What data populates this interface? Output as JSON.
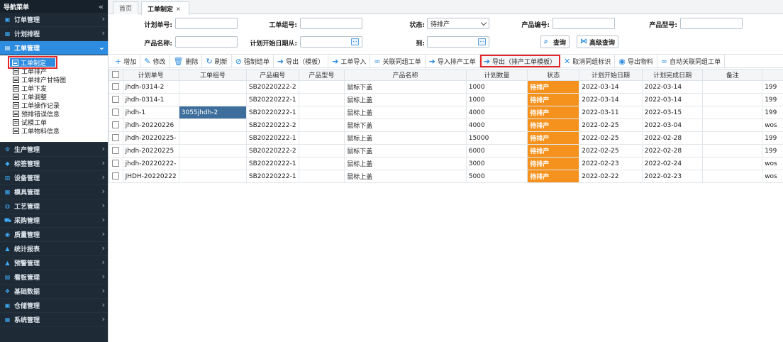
{
  "sidebar": {
    "title": "导航菜单",
    "collapse_icon": "«",
    "top_items": [
      {
        "label": "订单管理",
        "icon": "order-icon"
      },
      {
        "label": "计划排程",
        "icon": "schedule-icon"
      },
      {
        "label": "工单管理",
        "icon": "workorder-icon"
      }
    ],
    "sub_items": [
      {
        "label": "工单制定"
      },
      {
        "label": "工单排产"
      },
      {
        "label": "工单排产甘特图"
      },
      {
        "label": "工单下发"
      },
      {
        "label": "工单调整"
      },
      {
        "label": "工单操作记录"
      },
      {
        "label": "预排错误信息"
      },
      {
        "label": "试模工单"
      },
      {
        "label": "工单物料信息"
      }
    ],
    "bottom_items": [
      {
        "label": "生产管理"
      },
      {
        "label": "标签管理"
      },
      {
        "label": "设备管理"
      },
      {
        "label": "模具管理"
      },
      {
        "label": "工艺管理"
      },
      {
        "label": "采购管理"
      },
      {
        "label": "质量管理"
      },
      {
        "label": "统计报表"
      },
      {
        "label": "预警管理"
      },
      {
        "label": "看板管理"
      },
      {
        "label": "基础数据"
      },
      {
        "label": "仓储管理"
      },
      {
        "label": "系统管理"
      }
    ]
  },
  "tabs": [
    {
      "label": "首页"
    },
    {
      "label": "工单制定",
      "close": "×"
    }
  ],
  "filters": {
    "plan_no_label": "计划单号:",
    "plan_no_value": "",
    "order_group_label": "工单组号:",
    "order_group_value": "",
    "status_label": "状态:",
    "status_value": "待排产",
    "product_code_label": "产品编号:",
    "product_code_value": "",
    "product_model_label": "产品型号:",
    "product_model_value": "",
    "product_name_label": "产品名称:",
    "product_name_value": "",
    "start_date_label": "计划开始日期从:",
    "start_date_value": "",
    "to_label": "到:",
    "end_date_value": "",
    "search_btn": "查询",
    "advanced_btn": "高级查询"
  },
  "toolbar": [
    {
      "label": "增加",
      "icon": "+",
      "color": "#2d8ce0"
    },
    {
      "label": "修改",
      "icon": "✎",
      "color": "#2d8ce0"
    },
    {
      "label": "删除",
      "icon": "🗑",
      "color": "#2d8ce0"
    },
    {
      "label": "刷新",
      "icon": "↻",
      "color": "#2d8ce0"
    },
    {
      "label": "强制结单",
      "icon": "⊘",
      "color": "#2d8ce0"
    },
    {
      "label": "导出（模板）",
      "icon": "➜",
      "color": "#2d8ce0"
    },
    {
      "label": "工单导入",
      "icon": "➜",
      "color": "#2d8ce0"
    },
    {
      "label": "关联同组工单",
      "icon": "∞",
      "color": "#2d8ce0"
    },
    {
      "label": "导入排产工单",
      "icon": "➜",
      "color": "#2d8ce0"
    },
    {
      "label": "导出（排产工单模板）",
      "icon": "➜",
      "color": "#2d8ce0",
      "highlight": true
    },
    {
      "label": "取消同组标识",
      "icon": "✕",
      "color": "#2d8ce0"
    },
    {
      "label": "导出物料",
      "icon": "◉",
      "color": "#2d8ce0"
    },
    {
      "label": "自动关联同组工单",
      "icon": "∞",
      "color": "#2d8ce0"
    }
  ],
  "table": {
    "columns": [
      "计划单号",
      "工单组号",
      "产品编号",
      "产品型号",
      "产品名称",
      "计划数量",
      "状态",
      "计划开始日期",
      "计划完成日期",
      "备注",
      ""
    ],
    "rows": [
      [
        "jhdh-0314-2",
        "",
        "SB20220222-2",
        "",
        "鼠标下盖",
        "1000",
        "待排产",
        "2022-03-14",
        "2022-03-14",
        "",
        "199"
      ],
      [
        "jhdh-0314-1",
        "",
        "SB20220222-1",
        "",
        "鼠标上盖",
        "1000",
        "待排产",
        "2022-03-14",
        "2022-03-14",
        "",
        "199"
      ],
      [
        "jhdh-1",
        "3055jhdh-2",
        "SB20220222-1",
        "",
        "鼠标上盖",
        "4000",
        "待排产",
        "2022-03-11",
        "2022-03-15",
        "",
        "199"
      ],
      [
        "jhdh-20220226",
        "",
        "SB20220222-2",
        "",
        "鼠标下盖",
        "4000",
        "待排产",
        "2022-02-25",
        "2022-03-04",
        "",
        "wos"
      ],
      [
        "jhdh-20220225-",
        "",
        "SB20220222-1",
        "",
        "鼠标上盖",
        "15000",
        "待排产",
        "2022-02-25",
        "2022-02-28",
        "",
        "199"
      ],
      [
        "jhdh-20220225",
        "",
        "SB20220222-2",
        "",
        "鼠标下盖",
        "6000",
        "待排产",
        "2022-02-25",
        "2022-02-28",
        "",
        "199"
      ],
      [
        "jhdh-20220222-",
        "",
        "SB20220222-1",
        "",
        "鼠标上盖",
        "3000",
        "待排产",
        "2022-02-23",
        "2022-02-24",
        "",
        "wos"
      ],
      [
        "JHDH-20220222",
        "",
        "SB20220222-1",
        "",
        "鼠标上盖",
        "5000",
        "待排产",
        "2022-02-22",
        "2022-02-23",
        "",
        "wos"
      ]
    ]
  },
  "colors": {
    "sidebar_bg": "#1e2b37",
    "accent": "#2d8ce0",
    "status_pending": "#f4921d",
    "highlight_border": "#e3262a"
  }
}
